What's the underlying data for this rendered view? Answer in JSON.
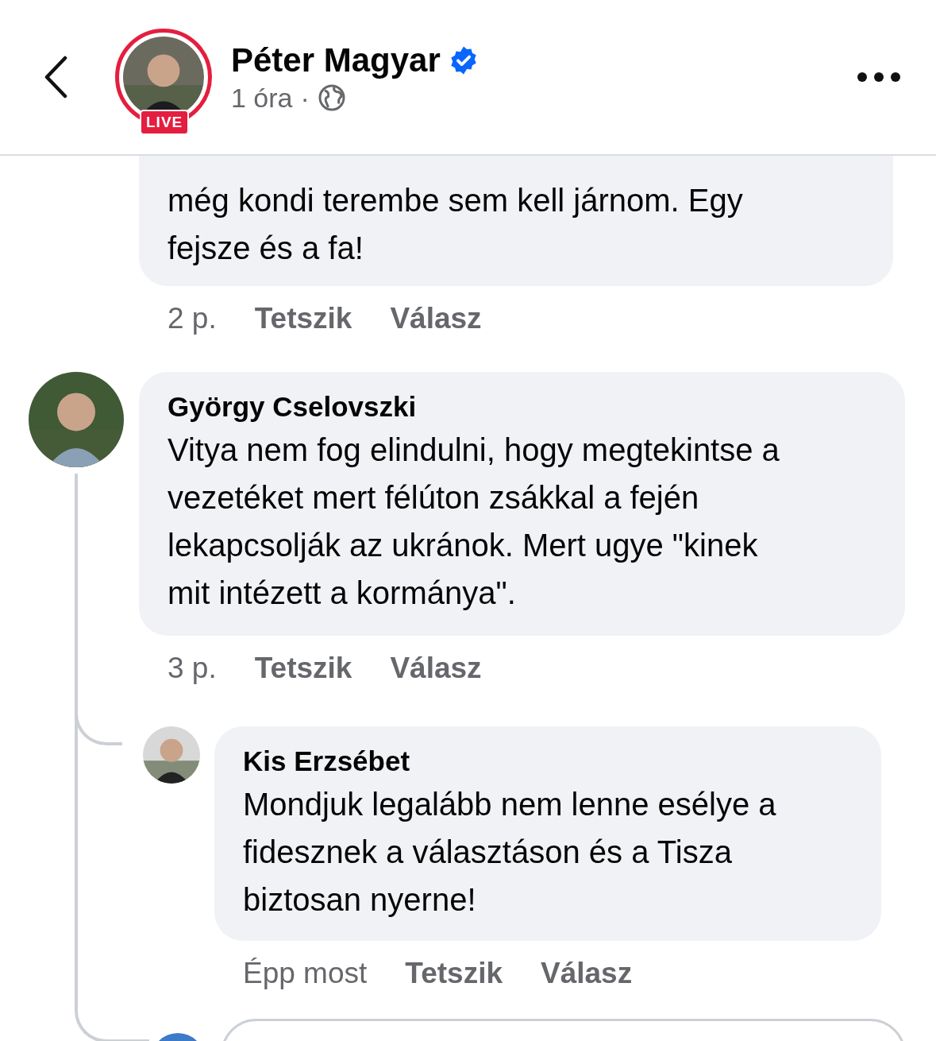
{
  "header": {
    "name": "Péter Magyar",
    "verified": true,
    "live_badge": "LIVE",
    "time": "1 óra",
    "separator": "·"
  },
  "comments": [
    {
      "lines": [
        "még kondi terembe sem kell járnom. Egy",
        "fejsze és a fa!"
      ],
      "time": "2 p.",
      "like": "Tetszik",
      "reply": "Válasz"
    },
    {
      "author": "György Cselovszki",
      "lines": [
        "Vitya nem fog elindulni, hogy megtekintse a",
        "vezetéket mert félúton zsákkal a fején",
        "lekapcsolják az ukránok. Mert ugye \"kinek",
        "mit intézett a kormánya\"."
      ],
      "time": "3 p.",
      "like": "Tetszik",
      "reply": "Válasz",
      "replies": [
        {
          "author": "Kis Erzsébet",
          "lines": [
            "Mondjuk legalább nem lenne esélye a",
            "fidesznek a választáson és a Tisza",
            "biztosan nyerne!"
          ],
          "time": "Épp most",
          "like": "Tetszik",
          "reply": "Válasz"
        }
      ]
    }
  ]
}
